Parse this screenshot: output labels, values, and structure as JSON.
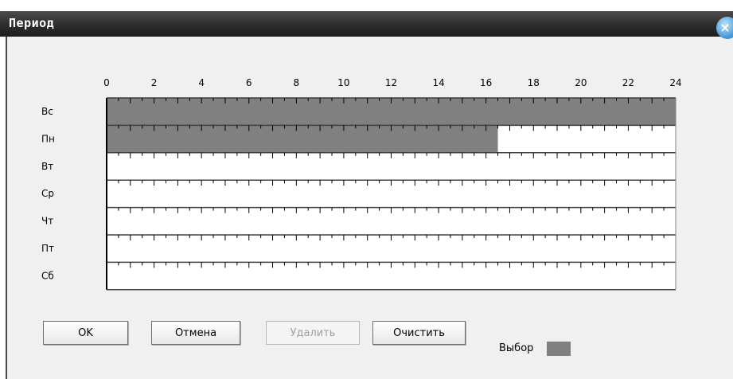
{
  "dialog": {
    "title": "Период",
    "close_icon": "close-icon"
  },
  "schedule": {
    "hours_max": 24,
    "hour_labels": [
      "0",
      "2",
      "4",
      "6",
      "8",
      "10",
      "12",
      "14",
      "16",
      "18",
      "20",
      "22",
      "24"
    ],
    "days": [
      {
        "label": "Вс",
        "selected_hours": [
          0,
          24
        ]
      },
      {
        "label": "Пн",
        "selected_hours": [
          0,
          16.5
        ]
      },
      {
        "label": "Вт",
        "selected_hours": null
      },
      {
        "label": "Ср",
        "selected_hours": null
      },
      {
        "label": "Чт",
        "selected_hours": null
      },
      {
        "label": "Пт",
        "selected_hours": null
      },
      {
        "label": "Сб",
        "selected_hours": null
      }
    ],
    "selected_color": "#808080"
  },
  "buttons": {
    "ok": "OK",
    "cancel": "Отмена",
    "delete": "Удалить",
    "clear": "Очистить"
  },
  "legend": {
    "label": "Выбор",
    "color": "#808080"
  }
}
